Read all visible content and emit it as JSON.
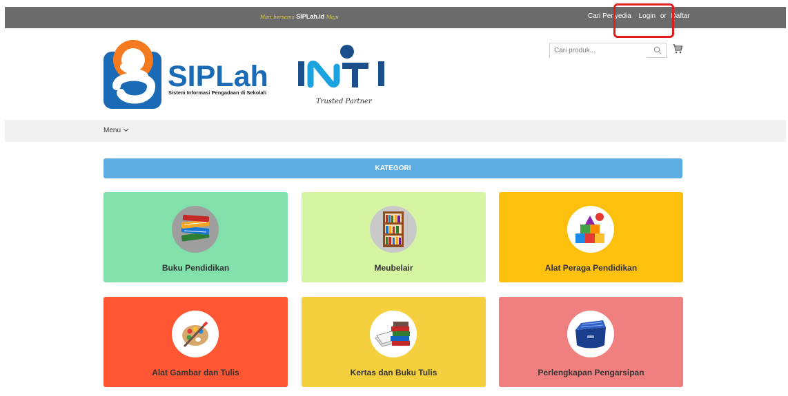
{
  "topbar": {
    "tagline_prefix": "Mari bersama",
    "tagline_brand": "SIPLah.id",
    "tagline_suffix": "Maju",
    "cari_penyedia": "Cari Penyedia",
    "login": "Login",
    "or": "or",
    "daftar": "Daftar"
  },
  "header": {
    "logo_siplah_text": "SIPLah",
    "logo_siplah_subtitle": "Sistem Informasi Pengadaan di Sekolah",
    "logo_initi_text": "INTI",
    "logo_initi_tagline": "Trusted Partner",
    "search_placeholder": "Cari produk..."
  },
  "menubar": {
    "menu_label": "Menu"
  },
  "kategori": {
    "title": "KATEGORI",
    "items": [
      {
        "label": "Buku Pendidikan",
        "icon": "books-icon"
      },
      {
        "label": "Meubelair",
        "icon": "bookshelf-icon"
      },
      {
        "label": "Alat Peraga Pendidikan",
        "icon": "toy-blocks-icon"
      },
      {
        "label": "Alat Gambar dan Tulis",
        "icon": "paint-palette-icon"
      },
      {
        "label": "Kertas dan Buku Tulis",
        "icon": "paper-books-icon"
      },
      {
        "label": "Perlengkapan Pengarsipan",
        "icon": "file-folder-icon"
      }
    ]
  },
  "colors": {
    "topbar": "#6b6b6b",
    "kategori_bar": "#5dade2",
    "highlight": "#e01e1e",
    "tiles": [
      "#82e0aa",
      "#d5f5a3",
      "#fdc10d",
      "#ff5733",
      "#f4d03f",
      "#f08080"
    ]
  }
}
